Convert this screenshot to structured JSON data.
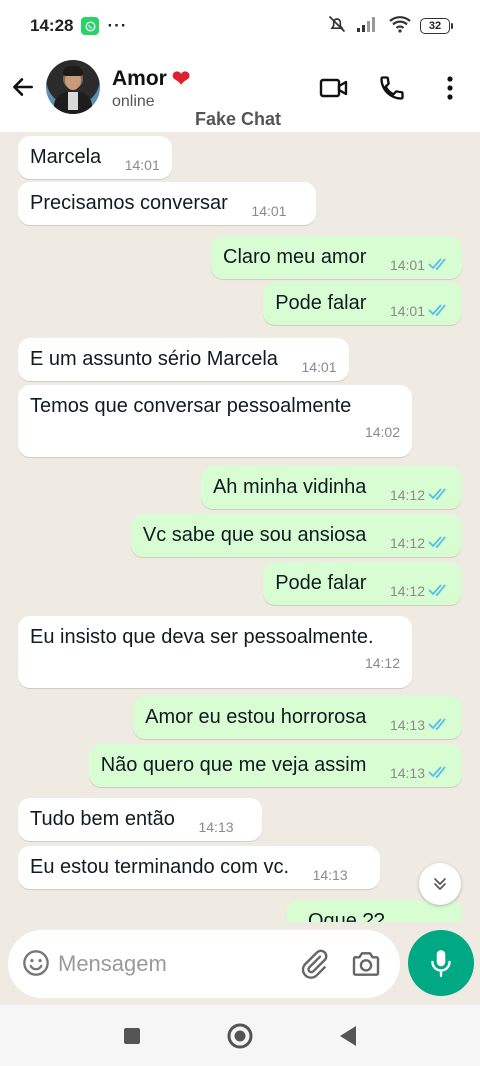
{
  "statusbar": {
    "time": "14:28",
    "battery": "32",
    "more": "···"
  },
  "header": {
    "contact_name": "Amor",
    "heart": "❤",
    "status": "online",
    "watermark": "Fake Chat"
  },
  "messages": [
    {
      "dir": "in",
      "text": "Marcela",
      "time": "14:01"
    },
    {
      "dir": "in",
      "text": "Precisamos conversar",
      "time": "14:01"
    },
    {
      "dir": "out",
      "text": "Claro meu amor",
      "time": "14:01",
      "read": true
    },
    {
      "dir": "out",
      "text": "Pode falar",
      "time": "14:01",
      "read": true
    },
    {
      "dir": "in",
      "text": "E um assunto sério Marcela",
      "time": "14:01"
    },
    {
      "dir": "in",
      "text": "Temos que conversar pessoalmente",
      "time": "14:02"
    },
    {
      "dir": "out",
      "text": "Ah minha vidinha",
      "time": "14:12",
      "read": true
    },
    {
      "dir": "out",
      "text": "Vc sabe que sou ansiosa",
      "time": "14:12",
      "read": true
    },
    {
      "dir": "out",
      "text": "Pode falar",
      "time": "14:12",
      "read": true
    },
    {
      "dir": "in",
      "text": "Eu insisto que deva ser pessoalmente.",
      "time": "14:12"
    },
    {
      "dir": "out",
      "text": "Amor eu estou horrorosa",
      "time": "14:13",
      "read": true
    },
    {
      "dir": "out",
      "text": "Não quero que me veja assim",
      "time": "14:13",
      "read": true
    },
    {
      "dir": "in",
      "text": "Tudo bem então",
      "time": "14:13"
    },
    {
      "dir": "in",
      "text": "Eu estou terminando com vc.",
      "time": "14:13"
    },
    {
      "dir": "out",
      "text": "Oque ??",
      "time": "",
      "read": true
    }
  ],
  "composer": {
    "placeholder": "Mensagem"
  },
  "colors": {
    "accent": "#00a884",
    "outgoing": "#d9fdd3",
    "incoming": "#ffffff",
    "read_ticks": "#53bdeb",
    "background": "#efeae2"
  },
  "icons": [
    "back-arrow-icon",
    "video-call-icon",
    "phone-icon",
    "more-vert-icon",
    "emoji-icon",
    "attach-icon",
    "camera-icon",
    "mic-icon",
    "scroll-down-icon",
    "nav-recents-icon",
    "nav-home-icon",
    "nav-back-icon"
  ]
}
